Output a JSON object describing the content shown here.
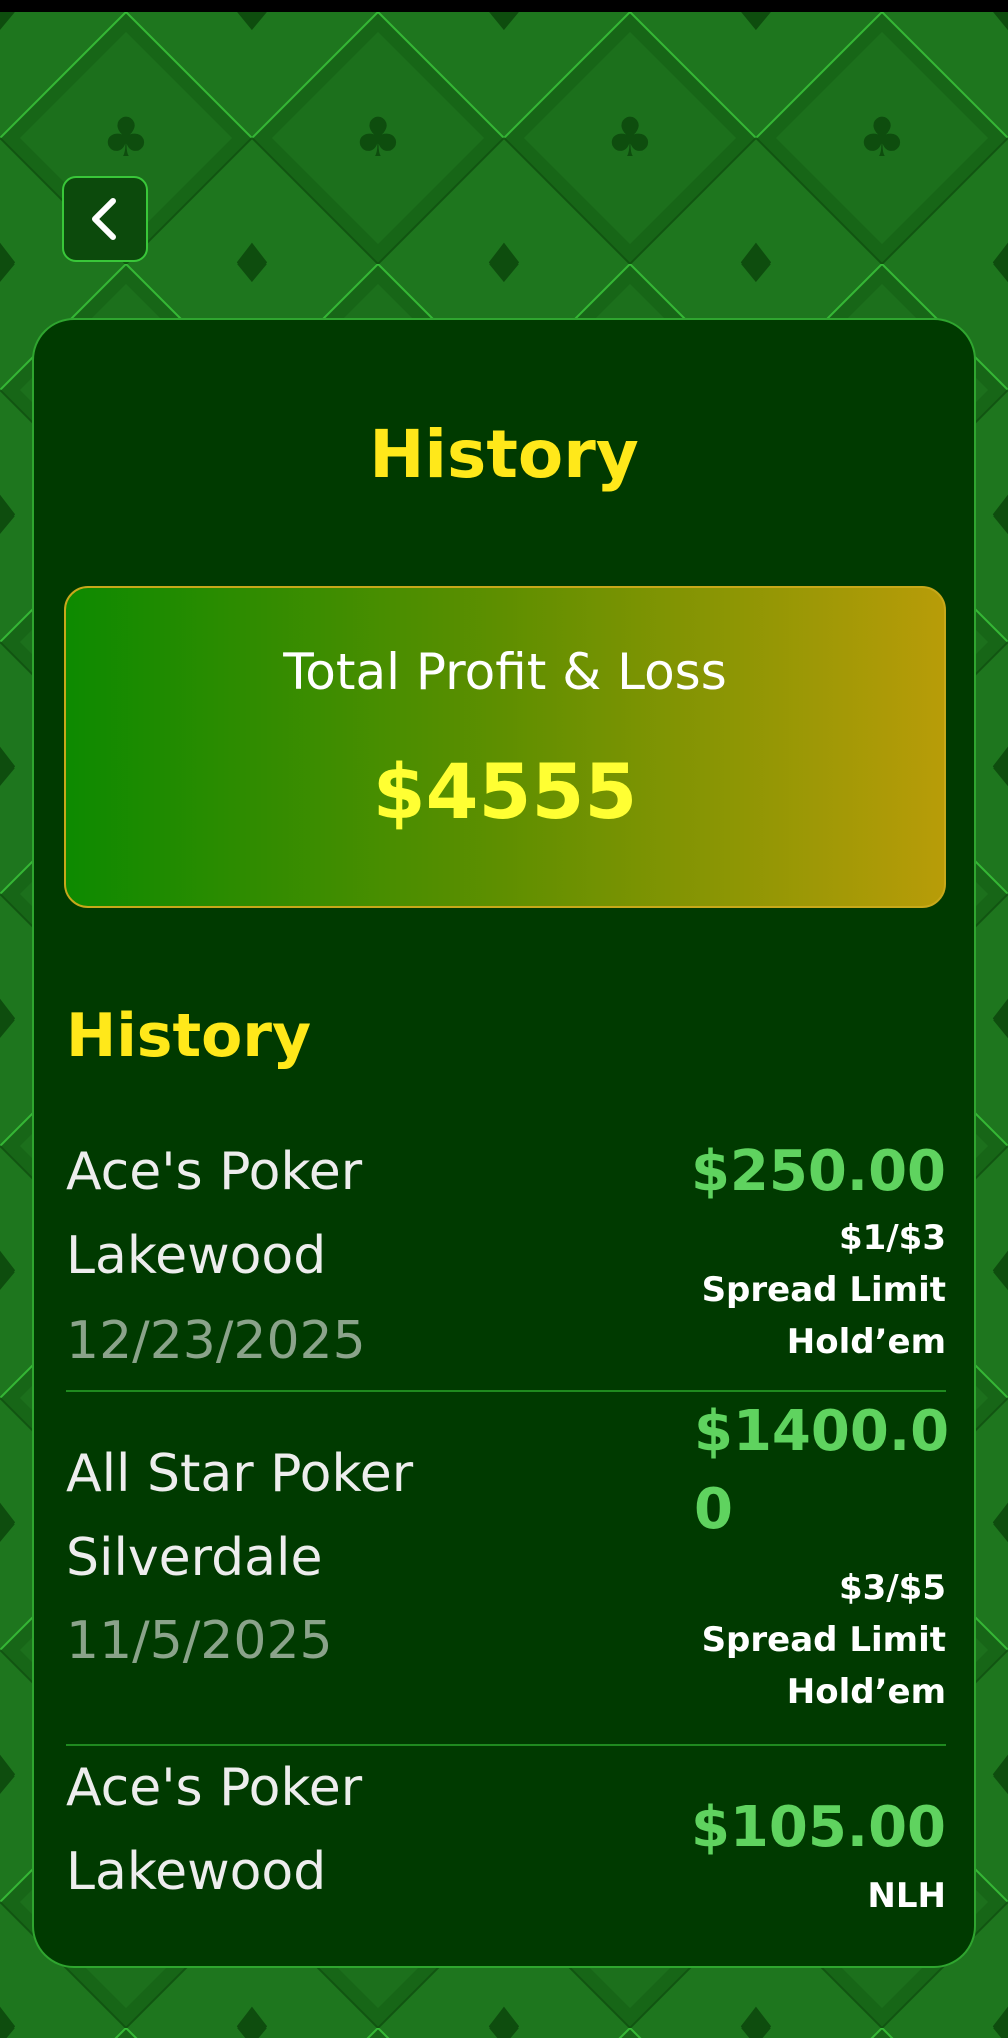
{
  "page": {
    "title": "History",
    "back_icon": "chevron-left-icon"
  },
  "summary": {
    "label": "Total Profit & Loss",
    "value": "$4555"
  },
  "history": {
    "section_title": "History",
    "items": [
      {
        "name_line1": "Ace's Poker",
        "name_line2": "Lakewood",
        "date": "12/23/2025",
        "amount": "$250.00",
        "stakes": "$1/$3",
        "game_line1": "Spread Limit",
        "game_line2": "Hold’em"
      },
      {
        "name_line1": "All Star Poker",
        "name_line2": "Silverdale",
        "date": "11/5/2025",
        "amount_line1": "$1400.0",
        "amount_line2": "0",
        "stakes": "$3/$5",
        "game_line1": "Spread Limit",
        "game_line2": "Hold’em"
      },
      {
        "name_line1": "Ace's Poker",
        "name_line2": "Lakewood",
        "amount": "$105.00",
        "game": "NLH"
      }
    ]
  },
  "colors": {
    "accent_yellow": "#ffe81a",
    "profit_green": "#5fd35f",
    "card_bg": "#003a00"
  }
}
